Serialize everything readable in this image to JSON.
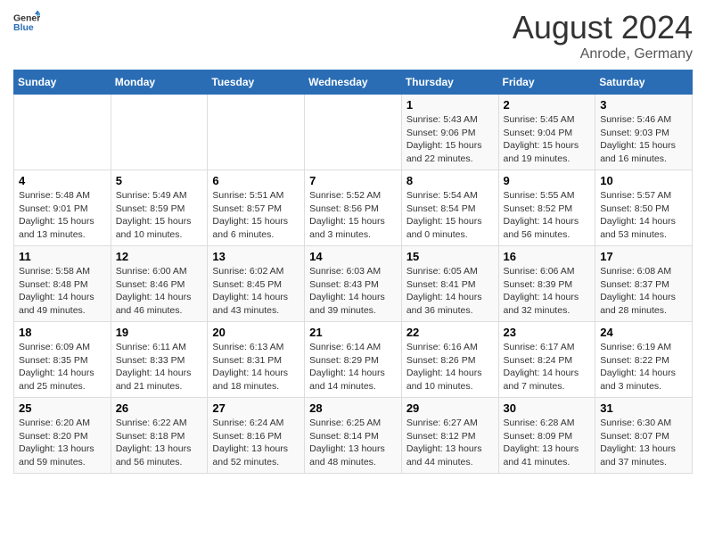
{
  "logo": {
    "general": "General",
    "blue": "Blue"
  },
  "header": {
    "month_year": "August 2024",
    "location": "Anrode, Germany"
  },
  "weekdays": [
    "Sunday",
    "Monday",
    "Tuesday",
    "Wednesday",
    "Thursday",
    "Friday",
    "Saturday"
  ],
  "weeks": [
    [
      {
        "day": "",
        "info": ""
      },
      {
        "day": "",
        "info": ""
      },
      {
        "day": "",
        "info": ""
      },
      {
        "day": "",
        "info": ""
      },
      {
        "day": "1",
        "info": "Sunrise: 5:43 AM\nSunset: 9:06 PM\nDaylight: 15 hours\nand 22 minutes."
      },
      {
        "day": "2",
        "info": "Sunrise: 5:45 AM\nSunset: 9:04 PM\nDaylight: 15 hours\nand 19 minutes."
      },
      {
        "day": "3",
        "info": "Sunrise: 5:46 AM\nSunset: 9:03 PM\nDaylight: 15 hours\nand 16 minutes."
      }
    ],
    [
      {
        "day": "4",
        "info": "Sunrise: 5:48 AM\nSunset: 9:01 PM\nDaylight: 15 hours\nand 13 minutes."
      },
      {
        "day": "5",
        "info": "Sunrise: 5:49 AM\nSunset: 8:59 PM\nDaylight: 15 hours\nand 10 minutes."
      },
      {
        "day": "6",
        "info": "Sunrise: 5:51 AM\nSunset: 8:57 PM\nDaylight: 15 hours\nand 6 minutes."
      },
      {
        "day": "7",
        "info": "Sunrise: 5:52 AM\nSunset: 8:56 PM\nDaylight: 15 hours\nand 3 minutes."
      },
      {
        "day": "8",
        "info": "Sunrise: 5:54 AM\nSunset: 8:54 PM\nDaylight: 15 hours\nand 0 minutes."
      },
      {
        "day": "9",
        "info": "Sunrise: 5:55 AM\nSunset: 8:52 PM\nDaylight: 14 hours\nand 56 minutes."
      },
      {
        "day": "10",
        "info": "Sunrise: 5:57 AM\nSunset: 8:50 PM\nDaylight: 14 hours\nand 53 minutes."
      }
    ],
    [
      {
        "day": "11",
        "info": "Sunrise: 5:58 AM\nSunset: 8:48 PM\nDaylight: 14 hours\nand 49 minutes."
      },
      {
        "day": "12",
        "info": "Sunrise: 6:00 AM\nSunset: 8:46 PM\nDaylight: 14 hours\nand 46 minutes."
      },
      {
        "day": "13",
        "info": "Sunrise: 6:02 AM\nSunset: 8:45 PM\nDaylight: 14 hours\nand 43 minutes."
      },
      {
        "day": "14",
        "info": "Sunrise: 6:03 AM\nSunset: 8:43 PM\nDaylight: 14 hours\nand 39 minutes."
      },
      {
        "day": "15",
        "info": "Sunrise: 6:05 AM\nSunset: 8:41 PM\nDaylight: 14 hours\nand 36 minutes."
      },
      {
        "day": "16",
        "info": "Sunrise: 6:06 AM\nSunset: 8:39 PM\nDaylight: 14 hours\nand 32 minutes."
      },
      {
        "day": "17",
        "info": "Sunrise: 6:08 AM\nSunset: 8:37 PM\nDaylight: 14 hours\nand 28 minutes."
      }
    ],
    [
      {
        "day": "18",
        "info": "Sunrise: 6:09 AM\nSunset: 8:35 PM\nDaylight: 14 hours\nand 25 minutes."
      },
      {
        "day": "19",
        "info": "Sunrise: 6:11 AM\nSunset: 8:33 PM\nDaylight: 14 hours\nand 21 minutes."
      },
      {
        "day": "20",
        "info": "Sunrise: 6:13 AM\nSunset: 8:31 PM\nDaylight: 14 hours\nand 18 minutes."
      },
      {
        "day": "21",
        "info": "Sunrise: 6:14 AM\nSunset: 8:29 PM\nDaylight: 14 hours\nand 14 minutes."
      },
      {
        "day": "22",
        "info": "Sunrise: 6:16 AM\nSunset: 8:26 PM\nDaylight: 14 hours\nand 10 minutes."
      },
      {
        "day": "23",
        "info": "Sunrise: 6:17 AM\nSunset: 8:24 PM\nDaylight: 14 hours\nand 7 minutes."
      },
      {
        "day": "24",
        "info": "Sunrise: 6:19 AM\nSunset: 8:22 PM\nDaylight: 14 hours\nand 3 minutes."
      }
    ],
    [
      {
        "day": "25",
        "info": "Sunrise: 6:20 AM\nSunset: 8:20 PM\nDaylight: 13 hours\nand 59 minutes."
      },
      {
        "day": "26",
        "info": "Sunrise: 6:22 AM\nSunset: 8:18 PM\nDaylight: 13 hours\nand 56 minutes."
      },
      {
        "day": "27",
        "info": "Sunrise: 6:24 AM\nSunset: 8:16 PM\nDaylight: 13 hours\nand 52 minutes."
      },
      {
        "day": "28",
        "info": "Sunrise: 6:25 AM\nSunset: 8:14 PM\nDaylight: 13 hours\nand 48 minutes."
      },
      {
        "day": "29",
        "info": "Sunrise: 6:27 AM\nSunset: 8:12 PM\nDaylight: 13 hours\nand 44 minutes."
      },
      {
        "day": "30",
        "info": "Sunrise: 6:28 AM\nSunset: 8:09 PM\nDaylight: 13 hours\nand 41 minutes."
      },
      {
        "day": "31",
        "info": "Sunrise: 6:30 AM\nSunset: 8:07 PM\nDaylight: 13 hours\nand 37 minutes."
      }
    ]
  ]
}
